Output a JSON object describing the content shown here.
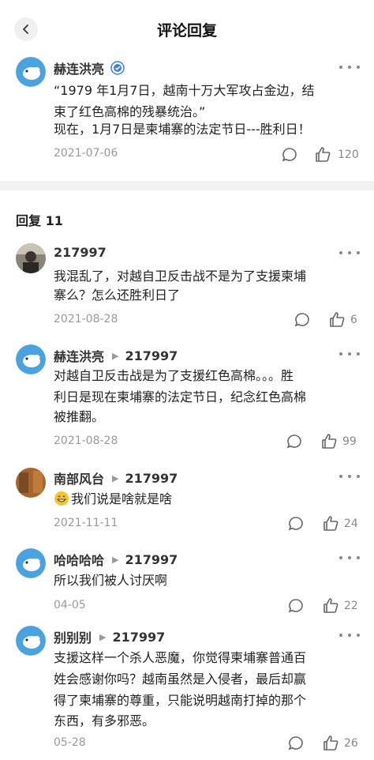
{
  "header": {
    "title": "评论回复"
  },
  "main_comment": {
    "user": "赫连洪亮",
    "text_line1": "“1979 年1月7日，越南十万大军攻占金边，结",
    "text_line2": "束了红色高棉的残暴统治。”",
    "text_line3": "现在，1月7日是柬埔寨的法定节日---胜利日！",
    "date": "2021-07-06",
    "likes": "120"
  },
  "replies_heading": "回复 11",
  "replies": [
    {
      "user": "217997",
      "reply_to": "",
      "text_lines": [
        "我混乱了，对越自卫反击战不是为了支援柬埔",
        "寨么？怎么还胜利日了"
      ],
      "date": "2021-08-28",
      "likes": "6"
    },
    {
      "user": "赫连洪亮",
      "reply_to": "217997",
      "text_lines": [
        "对越自卫反击战是为了支援红色高棉。。。胜",
        "利日是现在柬埔寨的法定节日，纪念红色高棉",
        "被推翻。"
      ],
      "date": "2021-08-28",
      "likes": "99"
    },
    {
      "user": "南部风台",
      "reply_to": "217997",
      "text_lines": [
        "我们说是啥就是啥"
      ],
      "date": "2021-11-11",
      "likes": "24"
    },
    {
      "user": "哈哈哈哈",
      "reply_to": "217997",
      "text_lines": [
        "所以我们被人讨厌啊"
      ],
      "date": "04-05",
      "likes": "22"
    },
    {
      "user": "别别别",
      "reply_to": "217997",
      "text_lines": [
        "支援这样一个杀人恶魔，你觉得柬埔寨普通百",
        "姓会感谢你吗？越南虽然是入侵者，最后却赢",
        "得了柬埔寨的尊重，只能说明越南打掉的那个",
        "东西，有多邪恶。"
      ],
      "date": "05-28",
      "likes": "26"
    }
  ],
  "colors": {
    "avatar_blue": "#4aa3df",
    "divider": "#f2f2f2",
    "muted": "#999999"
  },
  "icons": [
    "back-arrow",
    "verified-badge",
    "more-dots",
    "reply-bubble",
    "thumbs-up",
    "grin-emoji"
  ]
}
